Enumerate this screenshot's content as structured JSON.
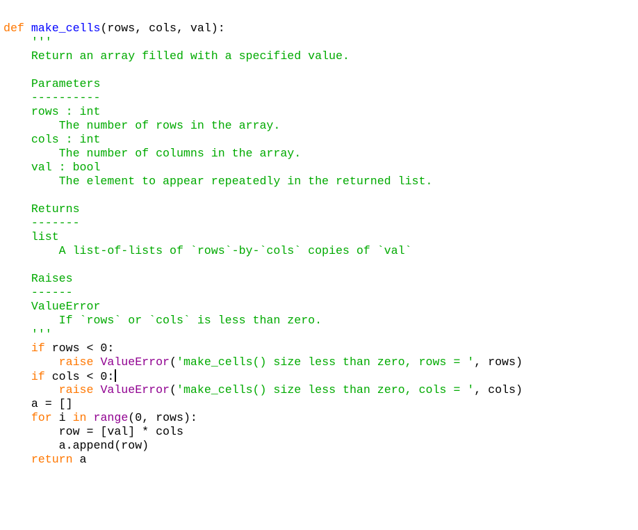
{
  "editor": {
    "lines": [
      {
        "tokens": [
          {
            "t": "kw",
            "v": "def "
          },
          {
            "t": "fn",
            "v": "make_cells"
          },
          {
            "t": "plain",
            "v": "(rows, cols, val):"
          }
        ]
      },
      {
        "tokens": [
          {
            "t": "plain",
            "v": "    "
          },
          {
            "t": "str",
            "v": "'''"
          }
        ]
      },
      {
        "tokens": [
          {
            "t": "str",
            "v": "    Return an array filled with a specified value."
          }
        ]
      },
      {
        "tokens": [
          {
            "t": "str",
            "v": ""
          }
        ]
      },
      {
        "tokens": [
          {
            "t": "str",
            "v": "    Parameters"
          }
        ]
      },
      {
        "tokens": [
          {
            "t": "str",
            "v": "    ----------"
          }
        ]
      },
      {
        "tokens": [
          {
            "t": "str",
            "v": "    rows : int"
          }
        ]
      },
      {
        "tokens": [
          {
            "t": "str",
            "v": "        The number of rows in the array."
          }
        ]
      },
      {
        "tokens": [
          {
            "t": "str",
            "v": "    cols : int"
          }
        ]
      },
      {
        "tokens": [
          {
            "t": "str",
            "v": "        The number of columns in the array."
          }
        ]
      },
      {
        "tokens": [
          {
            "t": "str",
            "v": "    val : bool"
          }
        ]
      },
      {
        "tokens": [
          {
            "t": "str",
            "v": "        The element to appear repeatedly in the returned list."
          }
        ]
      },
      {
        "tokens": [
          {
            "t": "str",
            "v": ""
          }
        ]
      },
      {
        "tokens": [
          {
            "t": "str",
            "v": "    Returns"
          }
        ]
      },
      {
        "tokens": [
          {
            "t": "str",
            "v": "    -------"
          }
        ]
      },
      {
        "tokens": [
          {
            "t": "str",
            "v": "    list"
          }
        ]
      },
      {
        "tokens": [
          {
            "t": "str",
            "v": "        A list-of-lists of `rows`-by-`cols` copies of `val`"
          }
        ]
      },
      {
        "tokens": [
          {
            "t": "str",
            "v": ""
          }
        ]
      },
      {
        "tokens": [
          {
            "t": "str",
            "v": "    Raises"
          }
        ]
      },
      {
        "tokens": [
          {
            "t": "str",
            "v": "    ------"
          }
        ]
      },
      {
        "tokens": [
          {
            "t": "str",
            "v": "    ValueError"
          }
        ]
      },
      {
        "tokens": [
          {
            "t": "str",
            "v": "        If `rows` or `cols` is less than zero."
          }
        ]
      },
      {
        "tokens": [
          {
            "t": "str",
            "v": "    '''"
          }
        ]
      },
      {
        "tokens": [
          {
            "t": "plain",
            "v": "    "
          },
          {
            "t": "kw",
            "v": "if"
          },
          {
            "t": "plain",
            "v": " rows < 0:"
          }
        ]
      },
      {
        "tokens": [
          {
            "t": "plain",
            "v": "        "
          },
          {
            "t": "kw",
            "v": "raise"
          },
          {
            "t": "plain",
            "v": " "
          },
          {
            "t": "bi",
            "v": "ValueError"
          },
          {
            "t": "plain",
            "v": "("
          },
          {
            "t": "str",
            "v": "'make_cells() size less than zero, rows = '"
          },
          {
            "t": "plain",
            "v": ", rows)"
          }
        ]
      },
      {
        "tokens": [
          {
            "t": "plain",
            "v": "    "
          },
          {
            "t": "kw",
            "v": "if"
          },
          {
            "t": "plain",
            "v": " cols < 0:"
          }
        ],
        "cursor": true
      },
      {
        "tokens": [
          {
            "t": "plain",
            "v": "        "
          },
          {
            "t": "kw",
            "v": "raise"
          },
          {
            "t": "plain",
            "v": " "
          },
          {
            "t": "bi",
            "v": "ValueError"
          },
          {
            "t": "plain",
            "v": "("
          },
          {
            "t": "str",
            "v": "'make_cells() size less than zero, cols = '"
          },
          {
            "t": "plain",
            "v": ", cols)"
          }
        ]
      },
      {
        "tokens": [
          {
            "t": "plain",
            "v": "    a = []"
          }
        ]
      },
      {
        "tokens": [
          {
            "t": "plain",
            "v": "    "
          },
          {
            "t": "kw",
            "v": "for"
          },
          {
            "t": "plain",
            "v": " i "
          },
          {
            "t": "kw",
            "v": "in"
          },
          {
            "t": "plain",
            "v": " "
          },
          {
            "t": "bi",
            "v": "range"
          },
          {
            "t": "plain",
            "v": "(0, rows):"
          }
        ]
      },
      {
        "tokens": [
          {
            "t": "plain",
            "v": "        row = [val] * cols"
          }
        ]
      },
      {
        "tokens": [
          {
            "t": "plain",
            "v": "        a.append(row)"
          }
        ]
      },
      {
        "tokens": [
          {
            "t": "plain",
            "v": "    "
          },
          {
            "t": "kw",
            "v": "return"
          },
          {
            "t": "plain",
            "v": " a"
          }
        ]
      }
    ]
  },
  "colors": {
    "keyword": "#ff7700",
    "function_name": "#0000ff",
    "string": "#00aa00",
    "builtin": "#900090",
    "plain": "#000000"
  }
}
